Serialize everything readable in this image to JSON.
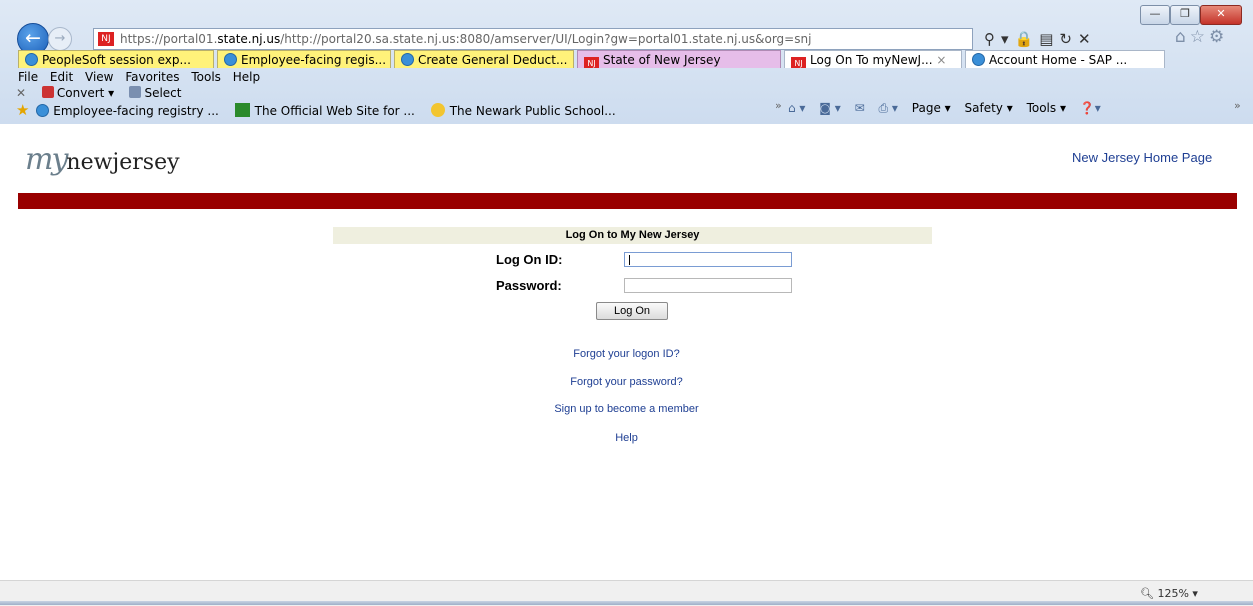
{
  "browser": {
    "address": {
      "prefix": "https://portal01.",
      "host": "state.nj.us",
      "rest": "/http://portal20.sa.state.nj.us:8080/amserver/UI/Login?gw=portal01.state.nj.us&org=snj",
      "favicon": "NJ"
    },
    "tabs": [
      {
        "label": "PeopleSoft session exp...",
        "icon": "ie-icon",
        "style": "yellow"
      },
      {
        "label": "Employee-facing regis...",
        "icon": "ie-icon",
        "style": "yellow"
      },
      {
        "label": "Create General Deduct...",
        "icon": "ie-icon",
        "style": "yellow"
      },
      {
        "label": "State of New Jersey",
        "icon": "nj-icon",
        "style": "pink"
      },
      {
        "label": "Log On To myNewJ...",
        "icon": "nj-icon",
        "style": "white",
        "close": "×"
      },
      {
        "label": "Account Home - SAP ...",
        "icon": "ie-icon",
        "style": "white"
      }
    ],
    "menu": [
      "File",
      "Edit",
      "View",
      "Favorites",
      "Tools",
      "Help"
    ],
    "toolbar": {
      "convert": "Convert ▾",
      "select": "Select"
    },
    "favorites": [
      "Employee-facing registry ...",
      "The Official Web Site for ...",
      "The Newark Public School..."
    ],
    "commands": {
      "page": "Page ▾",
      "safety": "Safety ▾",
      "tools": "Tools ▾"
    },
    "zoom": "125%"
  },
  "page": {
    "logo_my": "my",
    "logo_nj": "newjersey",
    "home_link": "New Jersey Home Page",
    "header": "Log On to My New Jersey",
    "logon_id_label": "Log On ID:",
    "password_label": "Password:",
    "logon_button": "Log On",
    "links": {
      "forgot_id": "Forgot your logon ID?",
      "forgot_password": "Forgot your password?",
      "signup": "Sign up to become a member",
      "help": "Help"
    }
  },
  "colors": {
    "brand_red": "#990000",
    "link_blue": "#1f3f93"
  }
}
